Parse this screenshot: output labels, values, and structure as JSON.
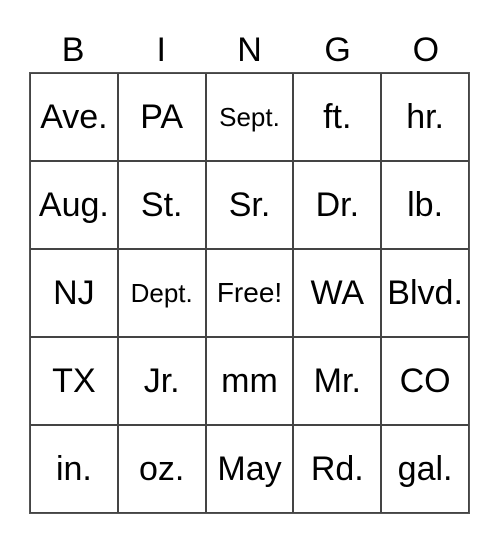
{
  "header": [
    "B",
    "I",
    "N",
    "G",
    "O"
  ],
  "cells": [
    "Ave.",
    "PA",
    "Sept.",
    "ft.",
    "hr.",
    "Aug.",
    "St.",
    "Sr.",
    "Dr.",
    "lb.",
    "NJ",
    "Dept.",
    "Free!",
    "WA",
    "Blvd.",
    "TX",
    "Jr.",
    "mm",
    "Mr.",
    "CO",
    "in.",
    "oz.",
    "May",
    "Rd.",
    "gal."
  ]
}
